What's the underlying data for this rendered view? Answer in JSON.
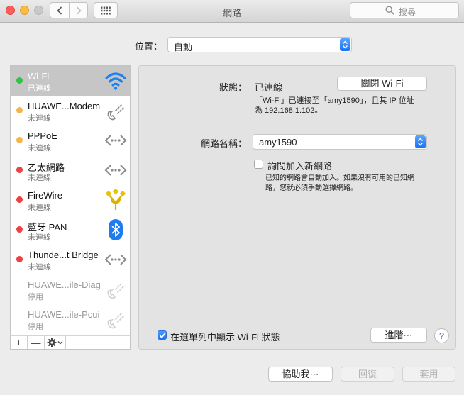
{
  "window": {
    "title": "網路",
    "search_placeholder": "搜尋"
  },
  "location": {
    "label": "位置：",
    "value": "自動"
  },
  "services": [
    {
      "name": "Wi-Fi",
      "status": "已連線",
      "dot_color": "#28c840",
      "icon": "wifi-icon",
      "selected": true,
      "disabled": false
    },
    {
      "name": "HUAWE...Modem",
      "status": "未連線",
      "dot_color": "#f5b54a",
      "icon": "phone-icon",
      "selected": false,
      "disabled": false
    },
    {
      "name": "PPPoE",
      "status": "未連線",
      "dot_color": "#f5b54a",
      "icon": "ethernet-arrows-icon",
      "selected": false,
      "disabled": false
    },
    {
      "name": "乙太網路",
      "status": "未連線",
      "dot_color": "#ee4242",
      "icon": "ethernet-arrows-icon",
      "selected": false,
      "disabled": false
    },
    {
      "name": "FireWire",
      "status": "未連線",
      "dot_color": "#ee4242",
      "icon": "firewire-icon",
      "selected": false,
      "disabled": false
    },
    {
      "name": "藍牙 PAN",
      "status": "未連線",
      "dot_color": "#ee4242",
      "icon": "bluetooth-icon",
      "selected": false,
      "disabled": false
    },
    {
      "name": "Thunde...t Bridge",
      "status": "未連線",
      "dot_color": "#ee4242",
      "icon": "ethernet-arrows-icon",
      "selected": false,
      "disabled": false
    },
    {
      "name": "HUAWE...ile-Diag",
      "status": "停用",
      "dot_color": "",
      "icon": "phone-icon",
      "selected": false,
      "disabled": true
    },
    {
      "name": "HUAWE...ile-Pcui",
      "status": "停用",
      "dot_color": "",
      "icon": "phone-icon",
      "selected": false,
      "disabled": true
    }
  ],
  "sidebar_tools": {
    "add": "+",
    "remove": "—"
  },
  "detail": {
    "status_label": "狀態：",
    "status_value": "已連線",
    "wifi_off_button": "關閉 Wi-Fi",
    "status_desc_line1": "「Wi-Fi」已連接至「amy1590」，且其 IP 位址",
    "status_desc_line2": "為 192.168.1.102。",
    "ssid_label": "網路名稱：",
    "ssid_value": "amy1590",
    "ask_join_label": "詢問加入新網路",
    "ask_join_checked": false,
    "ask_join_note_line1": "已知的網路會自動加入。如果沒有可用的已知網",
    "ask_join_note_line2": "路，您就必須手動選擇網路。",
    "show_in_menubar_label": "在選單列中顯示 Wi-Fi 狀態",
    "show_in_menubar_checked": true,
    "advanced_button": "進階⋯",
    "help_button": "?"
  },
  "footer": {
    "assist_button": "協助我⋯",
    "revert_button": "回復",
    "apply_button": "套用"
  },
  "colors": {
    "accent": "#1a72f4",
    "connected": "#28c840",
    "not_configured": "#f5b54a",
    "disconnected": "#ee4242"
  }
}
